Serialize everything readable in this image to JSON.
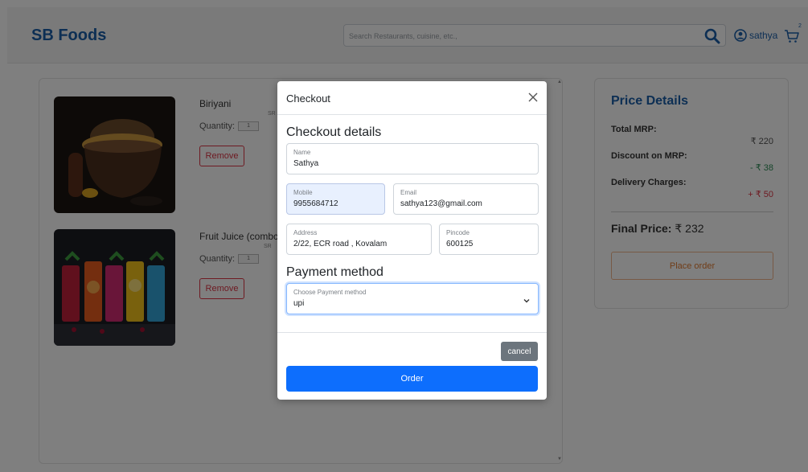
{
  "app": {
    "brand": "SB Foods"
  },
  "header": {
    "search_placeholder": "Search Restaurants, cuisine, etc.,",
    "user_name": "sathya",
    "cart_count": "2"
  },
  "cart_items": [
    {
      "name": "Biriyani",
      "quantity_label": "Quantity:",
      "quantity": "1",
      "sr_label": "SR",
      "remove_label": "Remove"
    },
    {
      "name": "Fruit Juice (combc",
      "quantity_label": "Quantity:",
      "quantity": "1",
      "sr_label": "SR",
      "remove_label": "Remove"
    }
  ],
  "price_details": {
    "title": "Price Details",
    "total_mrp_label": "Total MRP:",
    "total_mrp_value": "₹ 220",
    "discount_label": "Discount on MRP:",
    "discount_value": "- ₹ 38",
    "delivery_label": "Delivery Charges:",
    "delivery_value": "+ ₹ 50",
    "final_label": "Final Price:",
    "final_value": "₹ 232",
    "place_order_label": "Place order"
  },
  "colors": {
    "brand": "#1a5ea8",
    "discount": "#2e8b57",
    "delivery": "#dc3545",
    "primary": "#0d6efd",
    "secondary": "#6c757d"
  },
  "modal": {
    "title": "Checkout",
    "checkout_heading": "Checkout details",
    "name_label": "Name",
    "name_value": "Sathya",
    "mobile_label": "Mobile",
    "mobile_value": "9955684712",
    "email_label": "Email",
    "email_value": "sathya123@gmail.com",
    "address_label": "Address",
    "address_value": "2/22, ECR road , Kovalam",
    "pincode_label": "Pincode",
    "pincode_value": "600125",
    "payment_heading": "Payment method",
    "payment_label": "Choose Payment method",
    "payment_value": "upi",
    "cancel_label": "cancel",
    "order_label": "Order"
  },
  "icons": {
    "search": "search-icon",
    "user": "user-circle-icon",
    "cart": "cart-icon",
    "close": "close-icon",
    "chevron": "chevron-down-icon"
  }
}
